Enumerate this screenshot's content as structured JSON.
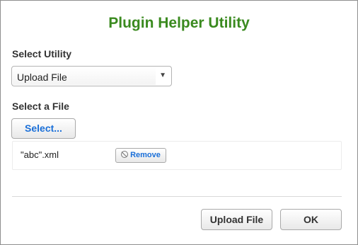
{
  "dialog": {
    "title": "Plugin Helper Utility"
  },
  "utility": {
    "label": "Select Utility",
    "selected": "Upload File",
    "arrow": "▼"
  },
  "file": {
    "label": "Select a File",
    "select_button": "Select...",
    "files": [
      {
        "name": "\"abc\".xml",
        "remove_label": "Remove"
      }
    ]
  },
  "footer": {
    "upload_button": "Upload File",
    "ok_button": "OK"
  },
  "colors": {
    "title": "#3a8a1f",
    "link_blue": "#1a6fd8"
  }
}
